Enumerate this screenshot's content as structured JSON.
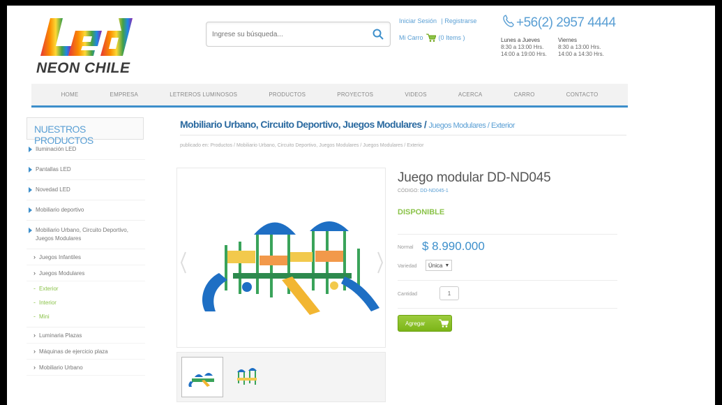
{
  "header": {
    "logo_text": "Led",
    "logo_subtext": "NEON CHILE",
    "search_placeholder": "Ingrese su búsqueda...",
    "login_link": "Iniciar Sesión",
    "register_link": "| Registrarse",
    "cart_label": "Mi Carro",
    "cart_items": "(0 Items )",
    "phone": "+56(2) 2957 4444",
    "hours": [
      {
        "days": "Lunes a Jueves",
        "am": "8:30 a 13:00 Hrs.",
        "pm": "14:00 a 19:00 Hrs."
      },
      {
        "days": "Viernes",
        "am": "8:30 a 13:00 Hrs.",
        "pm": "14:00 a 14:30 Hrs."
      }
    ]
  },
  "nav": {
    "items": [
      "HOME",
      "EMPRESA",
      "LETREROS LUMINOSOS",
      "PRODUCTOS",
      "PROYECTOS",
      "VIDEOS",
      "ACERCA",
      "CARRO",
      "CONTACTO"
    ]
  },
  "sidebar": {
    "title": "NUESTROS PRODUCTOS",
    "items": [
      "Iluminación LED",
      "Pantallas LED",
      "Novedad LED",
      "Mobiliario deportivo",
      "Mobiliario Urbano, Circuito Deportivo, Juegos Modulares"
    ],
    "subitems": [
      "Juegos Infantiles",
      "Juegos Modulares"
    ],
    "subsubitems": [
      "Exterior",
      "Interior",
      "Mini"
    ],
    "more_items": [
      "Luminaria Plazas",
      "Máquinas de ejercicio plaza",
      "Mobiliario Urbano"
    ]
  },
  "main": {
    "title_bold": "Mobiliario Urbano, Circuito Deportivo, Juegos Modulares /",
    "title_light": "Juegos Modulares / Exterior",
    "categories": "publicado en: Productos / Mobiliario Urbano, Circuito Deportivo, Juegos Modulares / Juegos Modulares / Exterior",
    "product_name": "Juego modular DD-ND045",
    "code_label": "CÓDIGO:",
    "code_value": "DD-ND045-1",
    "availability": "DISPONIBLE",
    "price_label": "Normal",
    "price": "$ 8.990.000",
    "variant_label": "Variedad",
    "variant_value": "Única",
    "quantity_label": "Cantidad",
    "quantity_value": "1",
    "add_button": "Agregar"
  },
  "colors": {
    "accent_blue": "#3d8fcb",
    "accent_green": "#8bc34a",
    "title_blue": "#2b6aa0"
  }
}
